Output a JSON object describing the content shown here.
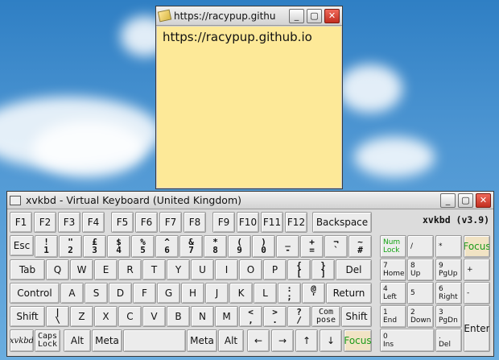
{
  "note": {
    "title": "https://racypup.githu",
    "content": "https://racypup.github.io",
    "buttons": {
      "minimize": "_",
      "maximize": "▢",
      "close": "✕"
    }
  },
  "keyboard": {
    "title": "xvkbd - Virtual Keyboard (United Kingdom)",
    "version": "xvkbd (v3.9)",
    "buttons": {
      "minimize": "_",
      "maximize": "▢",
      "close": "✕"
    },
    "keys": {
      "F1": "F1",
      "F2": "F2",
      "F3": "F3",
      "F4": "F4",
      "F5": "F5",
      "F6": "F6",
      "F7": "F7",
      "F8": "F8",
      "F9": "F9",
      "F10": "F10",
      "F11": "F11",
      "F12": "F12",
      "Backspace": "Backspace",
      "Esc": "Esc",
      "n1": [
        "!",
        "1"
      ],
      "n2": [
        "\"",
        "2"
      ],
      "n3": [
        "£",
        "3"
      ],
      "n4": [
        "$",
        "4"
      ],
      "n5": [
        "%",
        "5"
      ],
      "n6": [
        "^",
        "6"
      ],
      "n7": [
        "&",
        "7"
      ],
      "n8": [
        "*",
        "8"
      ],
      "n9": [
        "(",
        "9"
      ],
      "n0": [
        ")",
        "0"
      ],
      "minus": [
        "_",
        "-"
      ],
      "equal": [
        "+",
        "="
      ],
      "grave": [
        "¬",
        "`"
      ],
      "hash": [
        "~",
        "#"
      ],
      "Tab": "Tab",
      "Q": "Q",
      "W": "W",
      "E": "E",
      "R": "R",
      "T": "T",
      "Y": "Y",
      "U": "U",
      "I": "I",
      "O": "O",
      "P": "P",
      "lbracket": [
        "{",
        "["
      ],
      "rbracket": [
        "}",
        "]"
      ],
      "Del": "Del",
      "Control": "Control",
      "A": "A",
      "S": "S",
      "D": "D",
      "F": "F",
      "G": "G",
      "H": "H",
      "J": "J",
      "K": "K",
      "L": "L",
      "semicolon": [
        ":",
        ";"
      ],
      "apostrophe": [
        "@",
        "'"
      ],
      "Return": "Return",
      "ShiftL": "Shift",
      "backslash": [
        "|",
        "\\"
      ],
      "Z": "Z",
      "X": "X",
      "C": "C",
      "V": "V",
      "B": "B",
      "N": "N",
      "M": "M",
      "comma": [
        "<",
        ","
      ],
      "period": [
        ">",
        "."
      ],
      "slash": [
        "?",
        "/"
      ],
      "compose": [
        "Com",
        "pose"
      ],
      "ShiftR": "Shift",
      "logo": "xvkbd",
      "CapsLock": [
        "Caps",
        "Lock"
      ],
      "AltL": "Alt",
      "MetaL": "Meta",
      "Space": "",
      "MetaR": "Meta",
      "AltR": "Alt",
      "Left": "←",
      "Right": "→",
      "Up": "↑",
      "Down": "↓",
      "Focus": "Focus"
    },
    "keypad": {
      "NumLock": [
        "Num",
        "Lock"
      ],
      "div": [
        "/",
        ""
      ],
      "mul": [
        "*",
        ""
      ],
      "Focus": "Focus",
      "k7": [
        "7",
        "Home"
      ],
      "k8": [
        "8",
        "Up"
      ],
      "k9": [
        "9",
        "PgUp"
      ],
      "plus": [
        "+",
        ""
      ],
      "k4": [
        "4",
        "Left"
      ],
      "k5": [
        "5",
        ""
      ],
      "k6": [
        "6",
        "Right"
      ],
      "sub": [
        "-",
        ""
      ],
      "k1": [
        "1",
        "End"
      ],
      "k2": [
        "2",
        "Down"
      ],
      "k3": [
        "3",
        "PgDn"
      ],
      "Enter": "Enter",
      "k0": [
        "0",
        "Ins"
      ],
      "dot": [
        ".",
        "Del"
      ]
    }
  }
}
